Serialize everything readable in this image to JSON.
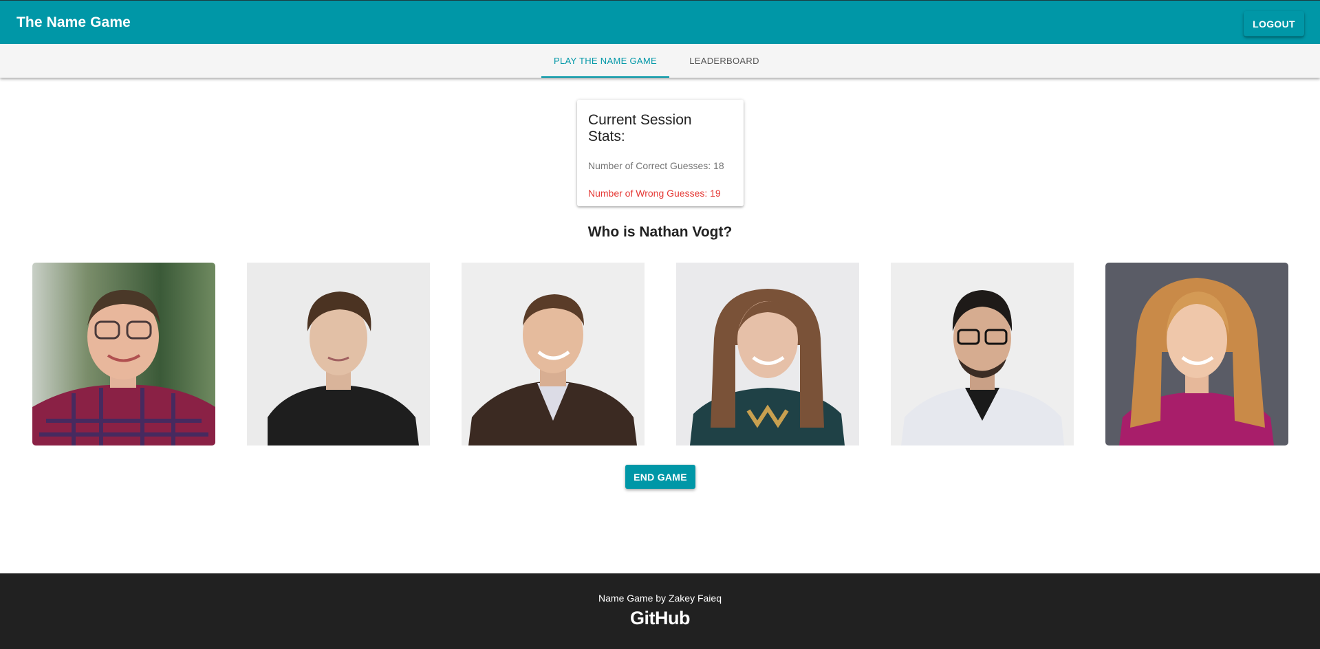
{
  "app": {
    "title": "The Name Game",
    "logout_label": "LOGOUT"
  },
  "tabs": [
    {
      "label": "PLAY THE NAME GAME",
      "active": true
    },
    {
      "label": "LEADERBOARD",
      "active": false
    }
  ],
  "stats": {
    "title": "Current Session Stats:",
    "correct_text": "Number of Correct Guesses: 18",
    "wrong_text": "Number of Wrong Guesses: 19"
  },
  "question": "Who is Nathan Vogt?",
  "photos": [
    {
      "icon": "portrait-photo",
      "description_hidden": true
    },
    {
      "icon": "portrait-photo",
      "description_hidden": true
    },
    {
      "icon": "portrait-photo",
      "description_hidden": true
    },
    {
      "icon": "portrait-photo",
      "description_hidden": true
    },
    {
      "icon": "portrait-photo",
      "description_hidden": true
    },
    {
      "icon": "portrait-photo",
      "description_hidden": true
    }
  ],
  "end_game_label": "END GAME",
  "footer": {
    "credit": "Name Game by Zakey Faieq",
    "github_label": "GitHub"
  },
  "colors": {
    "primary": "#0097a7",
    "footer_bg": "#212121",
    "wrong": "#e53935",
    "muted": "#757575"
  }
}
